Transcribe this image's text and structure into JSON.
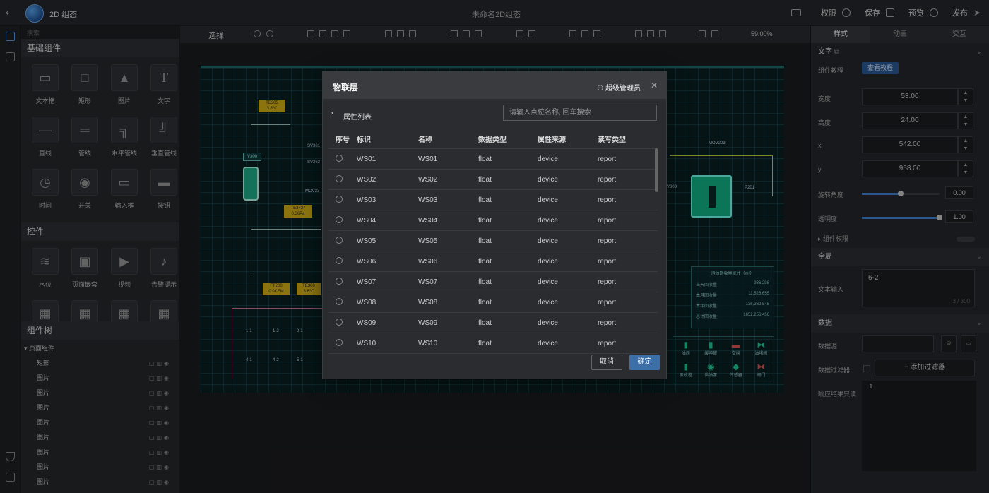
{
  "header": {
    "app_title": "2D 组态",
    "doc_title": "未命名2D组态",
    "actions": [
      "权限",
      "保存",
      "预览",
      "发布"
    ]
  },
  "left": {
    "search_placeholder": "搜索",
    "basic_title": "基础组件",
    "basic_items": [
      "文本框",
      "矩形",
      "图片",
      "文字",
      "直线",
      "管线",
      "水平管线",
      "垂直管线",
      "时间",
      "开关",
      "输入框",
      "按钮"
    ],
    "controls_title": "控件",
    "control_items": [
      "水位",
      "页面嵌套",
      "视频",
      "告警提示"
    ],
    "tree_title": "组件树",
    "tree_root": "页面组件",
    "tree_items": [
      "矩形",
      "图片",
      "图片",
      "图片",
      "图片",
      "图片",
      "图片",
      "图片",
      "图片"
    ]
  },
  "toolbar": {
    "select_label": "选择",
    "zoom": "59.00%"
  },
  "scene": {
    "tags": [
      "TE305",
      "3.8℃",
      "V300",
      "TE3437",
      "0.36Pa",
      "FT200",
      "0.0CFM",
      "TE300",
      "3.8℃"
    ],
    "labels": [
      "SV361",
      "SV362",
      "MOV33",
      "MOV203",
      "P201",
      "V303",
      "1-1",
      "1-2",
      "2-1",
      "4-1",
      "4-2",
      "5-1"
    ],
    "stats_title": "污油回收量统计（m³）",
    "stats": [
      {
        "label": "当天回收量",
        "value": "936.298"
      },
      {
        "label": "本月回收量",
        "value": "11,526.655"
      },
      {
        "label": "本年回收量",
        "value": "136,262.545"
      },
      {
        "label": "总计回收量",
        "value": "1652,256.456"
      }
    ],
    "legend": [
      "油阀",
      "缓冲罐",
      "交换",
      "油堵阀",
      "吸收塔",
      "供油泵",
      "传感器",
      "阀门"
    ]
  },
  "right": {
    "tabs": [
      "样式",
      "动画",
      "交互"
    ],
    "text_section": "文字",
    "tutorial_label": "组件教程",
    "tutorial_btn": "查看教程",
    "width_label": "宽度",
    "width": "53.00",
    "height_label": "高度",
    "height": "24.00",
    "x_label": "x",
    "x": "542.00",
    "y_label": "y",
    "y": "958.00",
    "rotate_label": "旋转角度",
    "rotate": "0.00",
    "rotate_frac": 0.5,
    "opacity_label": "透明度",
    "opacity": "1.00",
    "opacity_frac": 1.0,
    "perm_label": "组件权限",
    "global_section": "全局",
    "text_input_label": "文本输入",
    "text_input": "6-2",
    "text_count": "3 / 300",
    "data_section": "数据",
    "datasource_label": "数据源",
    "filter_label": "数据过滤器",
    "add_filter": "+ 添加过滤器",
    "response_label": "响应结果只读",
    "response_line": "1"
  },
  "modal": {
    "title": "物联层",
    "user": "超级管理员",
    "list_title": "属性列表",
    "search_placeholder": "请输入点位名称, 回车搜索",
    "columns": [
      "序号",
      "标识",
      "名称",
      "数据类型",
      "属性来源",
      "读写类型"
    ],
    "rows": [
      [
        "WS01",
        "WS01",
        "float",
        "device",
        "report"
      ],
      [
        "WS02",
        "WS02",
        "float",
        "device",
        "report"
      ],
      [
        "WS03",
        "WS03",
        "float",
        "device",
        "report"
      ],
      [
        "WS04",
        "WS04",
        "float",
        "device",
        "report"
      ],
      [
        "WS05",
        "WS05",
        "float",
        "device",
        "report"
      ],
      [
        "WS06",
        "WS06",
        "float",
        "device",
        "report"
      ],
      [
        "WS07",
        "WS07",
        "float",
        "device",
        "report"
      ],
      [
        "WS08",
        "WS08",
        "float",
        "device",
        "report"
      ],
      [
        "WS09",
        "WS09",
        "float",
        "device",
        "report"
      ],
      [
        "WS10",
        "WS10",
        "float",
        "device",
        "report"
      ]
    ],
    "cancel": "取消",
    "ok": "确定"
  }
}
